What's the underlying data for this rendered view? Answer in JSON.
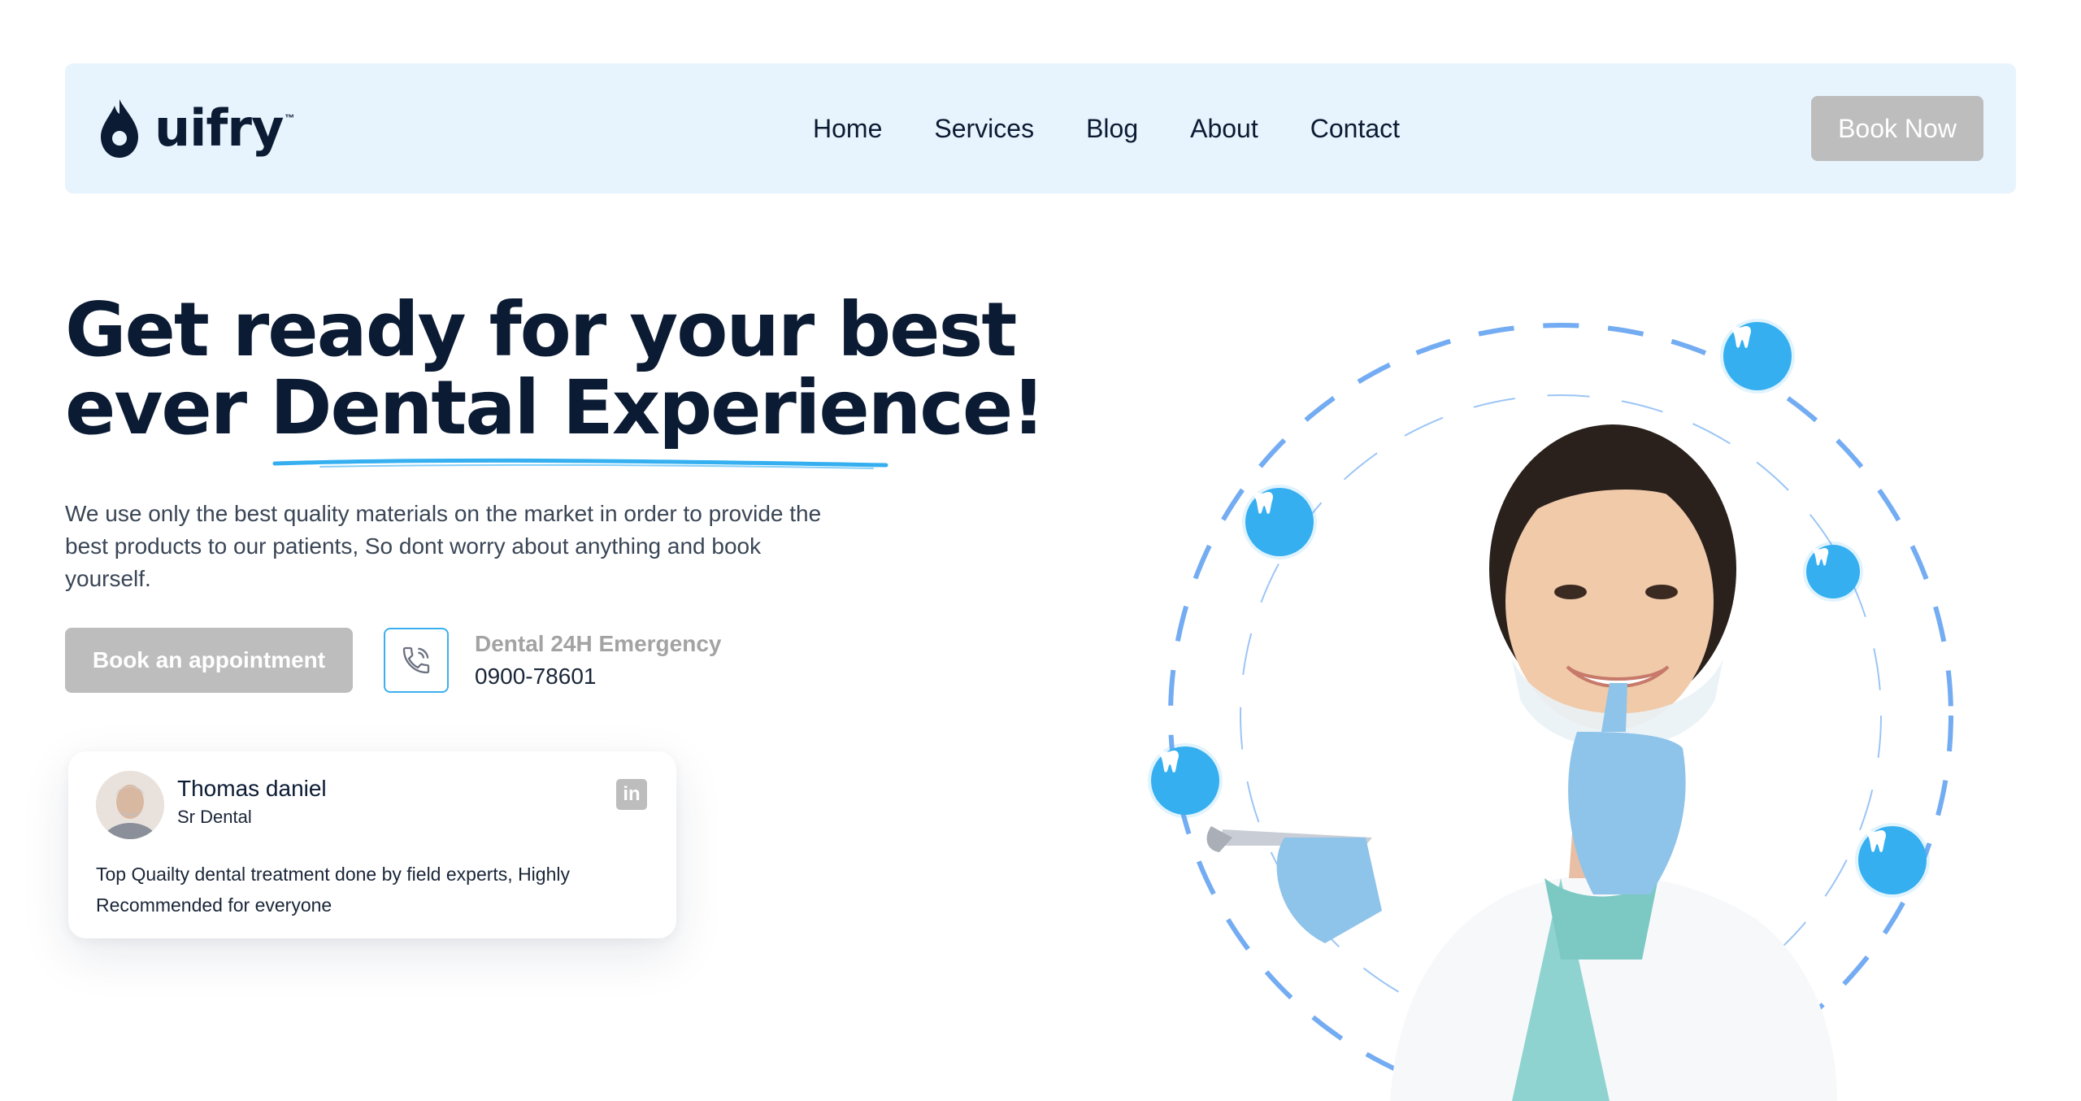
{
  "brand": {
    "name": "uifry",
    "tm": "™"
  },
  "nav": {
    "links": [
      "Home",
      "Services",
      "Blog",
      "About",
      "Contact"
    ],
    "cta": "Book Now"
  },
  "hero": {
    "title_line1": "Get ready for your best",
    "title_line2": "ever Dental Experience!",
    "description": "We use only the best quality materials on the market in order to provide the best products to our patients, So dont worry about anything and book yourself.",
    "book_button": "Book an appointment",
    "emergency_label": "Dental 24H Emergency",
    "emergency_phone": "0900-78601"
  },
  "testimonial": {
    "name": "Thomas daniel",
    "role": "Sr Dental",
    "text": "Top Quailty dental treatment done by field experts, Highly Recommended for everyone",
    "social_icon": "in"
  },
  "colors": {
    "accent": "#35aff0",
    "navbar_bg": "#e8f4fd",
    "button_gray": "#bdbdbd",
    "text_dark": "#0b1b33"
  },
  "icons": [
    "uifry-logo-drop",
    "phone-icon",
    "linkedin-icon",
    "tooth-icon"
  ]
}
